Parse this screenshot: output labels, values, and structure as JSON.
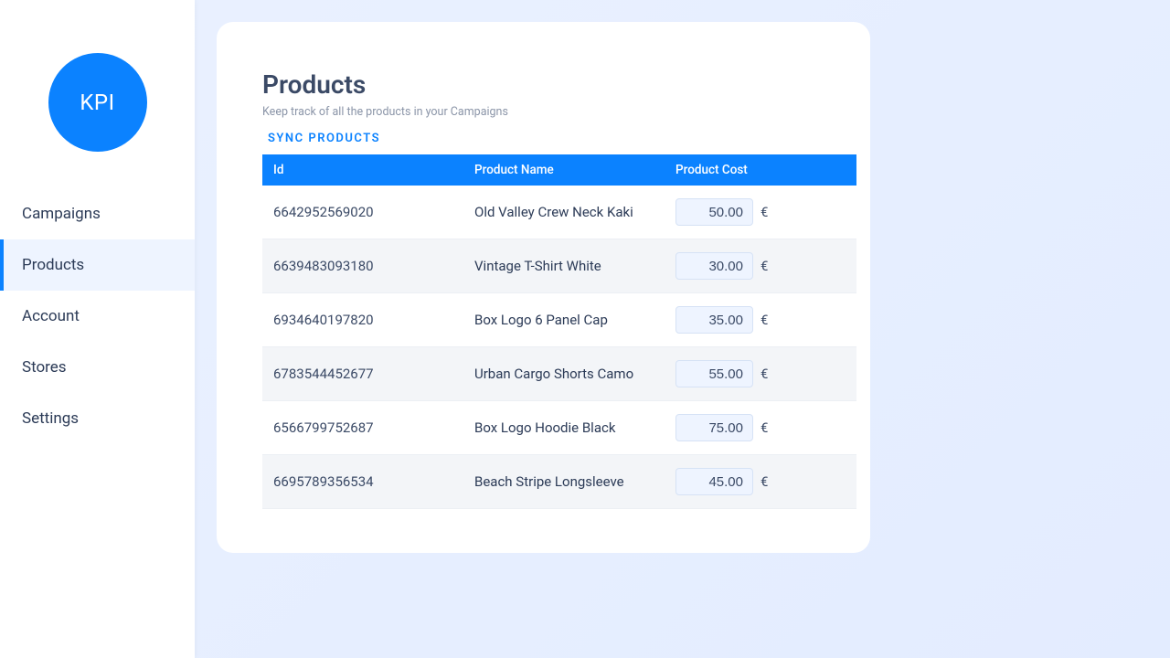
{
  "logo": {
    "label": "KPI"
  },
  "sidebar": {
    "items": [
      {
        "label": "Campaigns",
        "active": false
      },
      {
        "label": "Products",
        "active": true
      },
      {
        "label": "Account",
        "active": false
      },
      {
        "label": "Stores",
        "active": false
      },
      {
        "label": "Settings",
        "active": false
      }
    ]
  },
  "page": {
    "title": "Products",
    "subtitle": "Keep track of all the products in your Campaigns",
    "sync_label": "SYNC PRODUCTS"
  },
  "table": {
    "columns": {
      "id": "Id",
      "name": "Product Name",
      "cost": "Product Cost"
    },
    "currency": "€",
    "rows": [
      {
        "id": "6642952569020",
        "name": "Old Valley Crew Neck Kaki",
        "cost": "50.00"
      },
      {
        "id": "6639483093180",
        "name": "Vintage T-Shirt White",
        "cost": "30.00"
      },
      {
        "id": "6934640197820",
        "name": "Box Logo 6 Panel Cap",
        "cost": "35.00"
      },
      {
        "id": "6783544452677",
        "name": "Urban Cargo Shorts Camo",
        "cost": "55.00"
      },
      {
        "id": "6566799752687",
        "name": "Box Logo Hoodie Black",
        "cost": "75.00"
      },
      {
        "id": "6695789356534",
        "name": "Beach Stripe Longsleeve",
        "cost": "45.00"
      }
    ]
  }
}
